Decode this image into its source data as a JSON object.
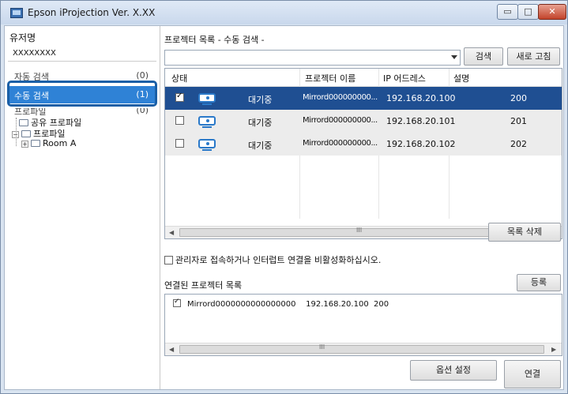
{
  "window": {
    "title": "Epson iProjection Ver. X.XX",
    "controls": {
      "minimize": "▭",
      "maximize": "□",
      "close": "✕"
    }
  },
  "sidebar": {
    "username_label": "유저명",
    "username_value": "XXXXXXXX",
    "items": [
      {
        "label": "자동 검색",
        "count": "(0)"
      },
      {
        "label": "수동 검색",
        "count": "(1)"
      },
      {
        "label": "프로파일",
        "count": "(0)"
      }
    ],
    "tree": {
      "shared_profile": "공유 프로파일",
      "profile": "프로파일",
      "room": "Room A"
    }
  },
  "main": {
    "list_title": "프로젝터 목록 - 수동 검색 -",
    "search_button": "검색",
    "refresh_button": "새로 고침",
    "columns": [
      "상태",
      "프로젝터 이름",
      "IP 어드레스",
      "설명"
    ],
    "rows": [
      {
        "checked": true,
        "status": "대기중",
        "name": "Mirrord000000000...",
        "ip": "192.168.20.100",
        "desc": "200"
      },
      {
        "checked": false,
        "status": "대기중",
        "name": "Mirrord000000000...",
        "ip": "192.168.20.101",
        "desc": "201"
      },
      {
        "checked": false,
        "status": "대기중",
        "name": "Mirrord000000000...",
        "ip": "192.168.20.102",
        "desc": "202"
      }
    ],
    "scroll_grip": "III",
    "delete_list_button": "목록 삭제",
    "admin_checkbox_label": "관리자로 접속하거나 인터럽트 연결을 비활성화하십시오.",
    "connected_title": "연결된 프로젝터 목록",
    "register_button": "등록",
    "connected_items": [
      {
        "checked": true,
        "name": "Mirrord0000000000000000",
        "ip": "192.168.20.100",
        "desc": "200"
      }
    ],
    "options_button": "옵션 설정",
    "connect_button": "연결"
  },
  "colors": {
    "selected_row": "#1f4f92",
    "active_nav": "#2f82d6",
    "focus_ring": "#1a5fa6",
    "projector_icon": "#2a79c9"
  }
}
